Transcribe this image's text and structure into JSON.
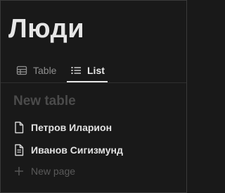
{
  "page": {
    "title": "Люди"
  },
  "tabs": [
    {
      "label": "Table",
      "icon": "table-icon",
      "active": false
    },
    {
      "label": "List",
      "icon": "list-icon",
      "active": true
    }
  ],
  "group": {
    "title": "New table"
  },
  "items": [
    {
      "label": "Петров Иларион",
      "icon": "page-icon"
    },
    {
      "label": "Иванов Сигизмунд",
      "icon": "page-icon"
    }
  ],
  "new_page": {
    "label": "New page",
    "icon": "plus-icon"
  },
  "colors": {
    "background": "#191919",
    "text_primary": "#e6e6e6",
    "text_muted": "#8e8e8e",
    "text_faint": "#4b4b4b"
  }
}
